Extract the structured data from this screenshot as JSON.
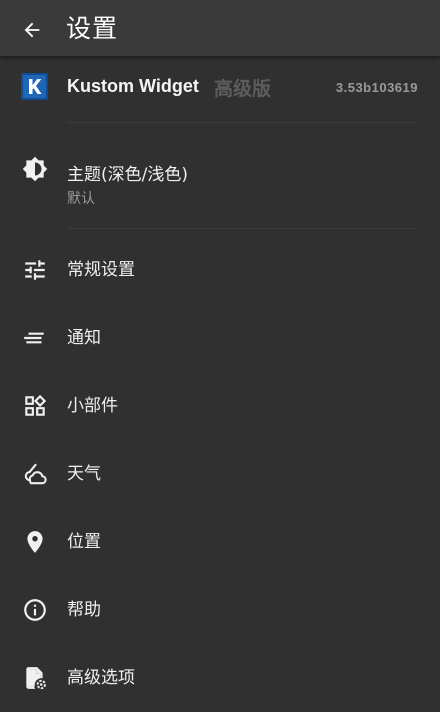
{
  "toolbar": {
    "title": "设置",
    "back_icon": "arrow-left-icon"
  },
  "app_info": {
    "name": "Kustom Widget",
    "edition": "高级版",
    "version": "3.53b103619",
    "logo_letter": "K",
    "logo_color": "#1e66b8"
  },
  "theme": {
    "title": "主题(深色/浅色)",
    "subtitle": "默认",
    "icon": "brightness-icon"
  },
  "menu": {
    "items": [
      {
        "label": "常规设置",
        "icon": "tune-sliders-icon"
      },
      {
        "label": "通知",
        "icon": "notification-lines-icon"
      },
      {
        "label": "小部件",
        "icon": "widgets-icon"
      },
      {
        "label": "天气",
        "icon": "weather-icon"
      },
      {
        "label": "位置",
        "icon": "location-pin-icon"
      },
      {
        "label": "帮助",
        "icon": "info-icon"
      },
      {
        "label": "高级选项",
        "icon": "file-settings-icon"
      }
    ]
  },
  "colors": {
    "background": "#303030",
    "toolbar": "#3a3a3a",
    "text_primary": "#f0f0f0",
    "text_secondary": "#9a9a9a"
  }
}
